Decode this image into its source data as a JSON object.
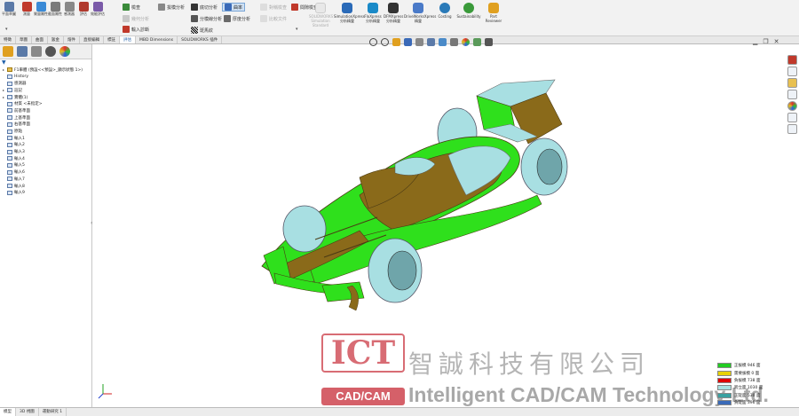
{
  "ribbon": {
    "groups": [
      {
        "label": "平面草圖",
        "color": "#5b7aa8"
      },
      {
        "label": "測量",
        "color": "#c0392b"
      },
      {
        "label": "質量屬性",
        "color": "#3a8ad6"
      },
      {
        "label": "截面屬性",
        "color": "#7a7a7a"
      },
      {
        "label": "感測器",
        "color": "#888888"
      },
      {
        "label": "評估",
        "color": "#b03a2e"
      },
      {
        "label": "效能評估",
        "color": "#7a5aa8"
      }
    ],
    "small_buttons": [
      {
        "label": "檢查",
        "dim": false
      },
      {
        "label": "幾何分析",
        "dim": true
      },
      {
        "label": "輸入診斷",
        "dim": false
      },
      {
        "label": "拔模分析",
        "dim": false
      },
      {
        "label": "底切分析",
        "dim": false
      },
      {
        "label": "分模線分析",
        "dim": false
      },
      {
        "label": "斑馬紋",
        "dim": false
      },
      {
        "label": "曲率",
        "dim": false
      },
      {
        "label": "厚度分析",
        "dim": false
      },
      {
        "label": "對稱檢查",
        "dim": true
      },
      {
        "label": "比較文件",
        "dim": true
      },
      {
        "label": "間隙檢查",
        "dim": false
      }
    ],
    "big_buttons": [
      {
        "label": "SimulationXpress 分析精靈",
        "dim": false
      },
      {
        "label": "FloXpress 分析精靈",
        "dim": false
      },
      {
        "label": "DFMXpress 分析精靈",
        "dim": false
      },
      {
        "label": "DriveWorksXpress 精靈",
        "dim": false
      },
      {
        "label": "Costing",
        "dim": false
      },
      {
        "label": "Sustainability",
        "dim": false
      },
      {
        "label": "Part Reviewer",
        "dim": false
      }
    ],
    "dim_label": "SOLIDWORKS Simulation Standard"
  },
  "tabs": [
    {
      "label": "特徵",
      "active": false
    },
    {
      "label": "草圖",
      "active": false
    },
    {
      "label": "曲面",
      "active": false
    },
    {
      "label": "鈑金",
      "active": false
    },
    {
      "label": "熔件",
      "active": false
    },
    {
      "label": "直接編輯",
      "active": false
    },
    {
      "label": "標註",
      "active": false
    },
    {
      "label": "評估",
      "active": true
    },
    {
      "label": "MBD Dimensions",
      "active": false
    },
    {
      "label": "SOLIDWORKS 插件",
      "active": false
    }
  ],
  "tree": {
    "root": "F1車體 (預設<<預設>_顯示狀態 1>)",
    "items": [
      {
        "label": "History",
        "exp": ""
      },
      {
        "label": "感測器",
        "exp": ""
      },
      {
        "label": "註記",
        "exp": "▸"
      },
      {
        "label": "實體(1)",
        "exp": "▸"
      },
      {
        "label": "材質 <未指定>",
        "exp": ""
      },
      {
        "label": "前基準面",
        "exp": ""
      },
      {
        "label": "上基準面",
        "exp": ""
      },
      {
        "label": "右基準面",
        "exp": ""
      },
      {
        "label": "原點",
        "exp": ""
      },
      {
        "label": "輸入1",
        "exp": ""
      },
      {
        "label": "輸入2",
        "exp": ""
      },
      {
        "label": "輸入3",
        "exp": ""
      },
      {
        "label": "輸入4",
        "exp": ""
      },
      {
        "label": "輸入5",
        "exp": ""
      },
      {
        "label": "輸入6",
        "exp": ""
      },
      {
        "label": "輸入7",
        "exp": ""
      },
      {
        "label": "輸入8",
        "exp": ""
      },
      {
        "label": "輸入9",
        "exp": ""
      }
    ]
  },
  "status_tabs": [
    {
      "label": "模型",
      "active": true
    },
    {
      "label": "3D 視圖",
      "active": false
    },
    {
      "label": "運動研究 1",
      "active": false
    }
  ],
  "logo": {
    "ict": "ICT",
    "cadcam": "CAD/CAM",
    "chinese": "智誠科技有限公司",
    "english": "Intelligent CAD/CAM Technology Ltd."
  },
  "legend": [
    {
      "label": "正拔模  946 面",
      "color": "#22cc22"
    },
    {
      "label": "需要拔模  0 面",
      "color": "#e8d200"
    },
    {
      "label": "負拔模  738 面",
      "color": "#e00000"
    },
    {
      "label": "跨立面  1030 面",
      "color": "#a8e0e0"
    },
    {
      "label": "正陡面  530 面",
      "color": "#3aa0a0"
    },
    {
      "label": "負陡面  396 面",
      "color": "#3a6ab8"
    }
  ],
  "colors": {
    "green": "#2fe01c",
    "olive": "#8a6a1a",
    "cyan": "#a8dfe2",
    "dark": "#4a3a14",
    "accent": "#1f5fa8"
  }
}
